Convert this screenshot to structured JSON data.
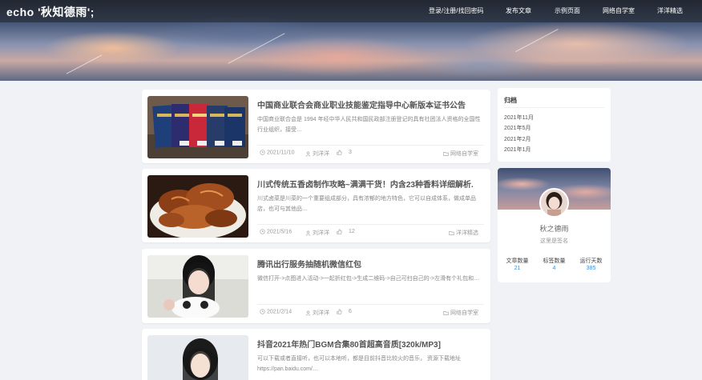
{
  "header": {
    "logo": "echo '秋知德雨';",
    "nav": [
      "登录/注册/找回密码",
      "发布文章",
      "示例页面",
      "网络自学室",
      "洋洋精选"
    ]
  },
  "posts": [
    {
      "title": "中国商业联合会商业职业技能鉴定指导中心新版本证书公告",
      "excerpt": "中国商业联合会是 1994 年经中华人民共和国民政部注册登记的具有社团法人资格的全国性行业组织，接受…",
      "date": "2021/11/10",
      "author": "刘洋洋",
      "likes": "3",
      "category": "网络自学室",
      "thumb": "certificates"
    },
    {
      "title": "川式传统五香卤制作攻略~满满干货！内含23种香料详细解析.",
      "excerpt": "川式卤菜是川菜的一个重要组成部分，具有浓郁的地方特色，它可以自成体系，做成单品店，也可与其他品…",
      "date": "2021/5/16",
      "author": "刘洋洋",
      "likes": "12",
      "category": "洋洋精选",
      "thumb": "braised-food"
    },
    {
      "title": "腾讯出行服务抽随机微信红包",
      "excerpt": "微信打开->点图进入活动->一起折红包->生成二维码->自己可扫自己的->左滑有个礼包和…",
      "date": "2021/2/14",
      "author": "刘洋洋",
      "likes": "6",
      "category": "网络自学室",
      "thumb": "girl-portrait"
    },
    {
      "title": "抖音2021年热门BGM合集80首超高音质[320k/MP3]",
      "excerpt": "可以下载或者直接听，也可以本地听，都是目前抖音比较火的音乐， 资源下载地址 https://pan.baidu.com/…",
      "date": "",
      "author": "",
      "likes": "",
      "category": "",
      "thumb": "girl-portrait-2"
    }
  ],
  "archive": {
    "title": "归档",
    "items": [
      "2021年11月",
      "2021年5月",
      "2021年2月",
      "2021年1月"
    ]
  },
  "profile": {
    "name": "秋之德雨",
    "signature": "这里是签名",
    "stats": [
      {
        "label": "文章数量",
        "value": "21"
      },
      {
        "label": "标签数量",
        "value": "4"
      },
      {
        "label": "运行天数",
        "value": "385"
      }
    ]
  },
  "colors": {
    "accent": "#3a8fd9",
    "nav_bg": "#1e2026",
    "page_bg": "#f0f2f5"
  },
  "icons": [
    "calendar-icon",
    "user-icon",
    "like-icon",
    "folder-icon"
  ]
}
